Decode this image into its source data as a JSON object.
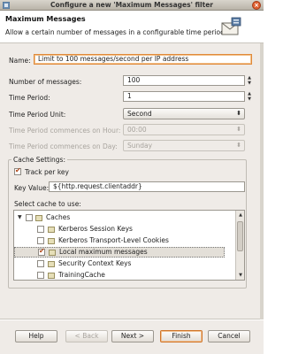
{
  "window": {
    "title": "Configure a new 'Maximum Messages' filter",
    "close_glyph": "×"
  },
  "header": {
    "title": "Maximum Messages",
    "description": "Allow a certain number of messages in a configurable time period."
  },
  "form": {
    "name_label": "Name:",
    "name_value": "Limit to 100 messages/second per IP address",
    "number_label": "Number of messages:",
    "number_value": "100",
    "period_label": "Time Period:",
    "period_value": "1",
    "unit_label": "Time Period Unit:",
    "unit_value": "Second",
    "hour_label": "Time Period commences on Hour:",
    "hour_value": "00:00",
    "day_label": "Time Period commences on Day:",
    "day_value": "Sunday"
  },
  "cache_settings": {
    "group_title": "Cache Settings:",
    "track_per_key_label": "Track per key",
    "track_per_key_checked": true,
    "key_value_label": "Key Value:",
    "key_value": "${http.request.clientaddr}",
    "select_cache_label": "Select cache to use:",
    "tree": [
      {
        "label": "Caches",
        "level": 0,
        "checked": false,
        "expanded": true
      },
      {
        "label": "Kerberos Session Keys",
        "level": 1,
        "checked": false
      },
      {
        "label": "Kerberos Transport-Level Cookies",
        "level": 1,
        "checked": false
      },
      {
        "label": "Local maximum messages",
        "level": 1,
        "checked": true,
        "selected": true
      },
      {
        "label": "Security Context Keys",
        "level": 1,
        "checked": false
      },
      {
        "label": "TrainingCache",
        "level": 1,
        "checked": false
      }
    ]
  },
  "buttons": {
    "help": "Help",
    "back": "< Back",
    "next": "Next >",
    "finish": "Finish",
    "cancel": "Cancel"
  },
  "colors": {
    "accent_focus": "#e08a3a",
    "check_mark": "#b0481a",
    "dialog_bg": "#efebe7"
  }
}
